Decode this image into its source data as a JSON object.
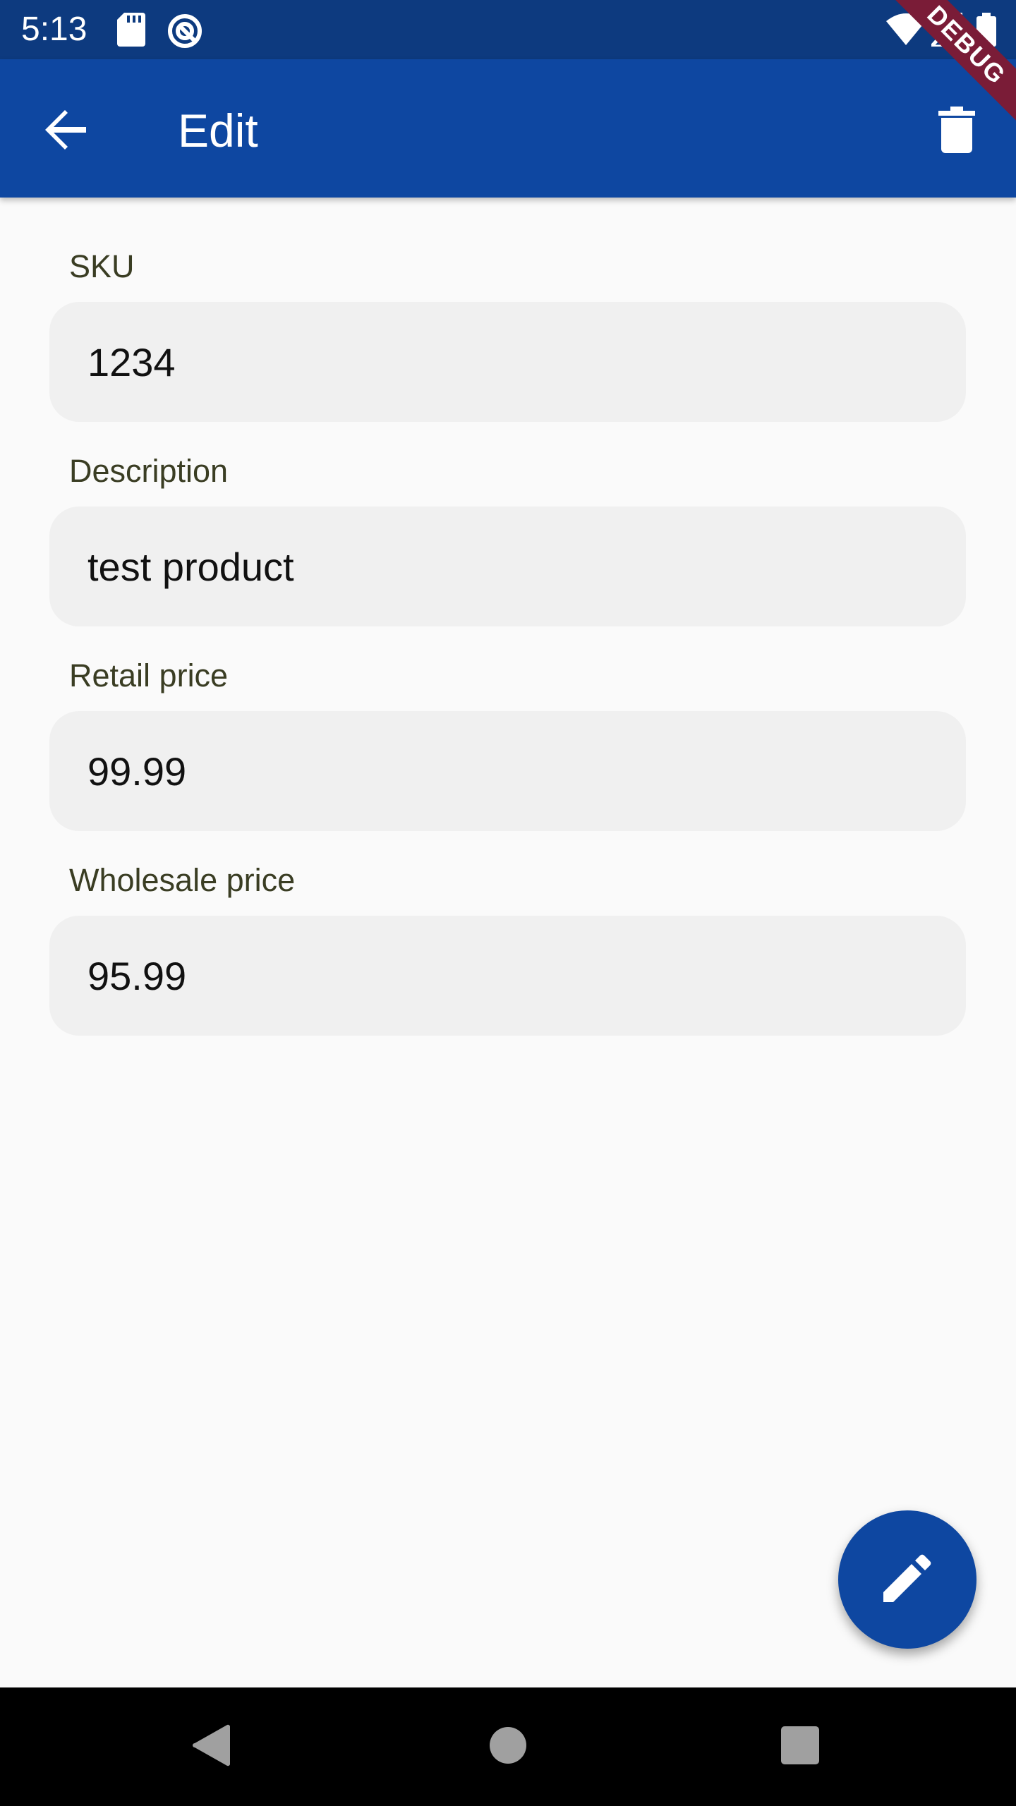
{
  "status_bar": {
    "time": "5:13",
    "icons": [
      "sd-card-icon",
      "sync-icon",
      "wifi-icon",
      "signal-icon",
      "battery-icon"
    ]
  },
  "debug_banner": "DEBUG",
  "app_bar": {
    "title": "Edit",
    "back_icon": "arrow-back-icon",
    "delete_icon": "trash-icon",
    "color": "#0e47a1"
  },
  "form": {
    "fields": [
      {
        "label": "SKU",
        "value": "1234"
      },
      {
        "label": "Description",
        "value": "test product"
      },
      {
        "label": "Retail price",
        "value": "99.99"
      },
      {
        "label": "Wholesale price",
        "value": "95.99"
      }
    ]
  },
  "fab": {
    "icon": "pencil-icon"
  },
  "nav_bar": {
    "icons": [
      "back-triangle-icon",
      "home-circle-icon",
      "recents-square-icon"
    ]
  }
}
